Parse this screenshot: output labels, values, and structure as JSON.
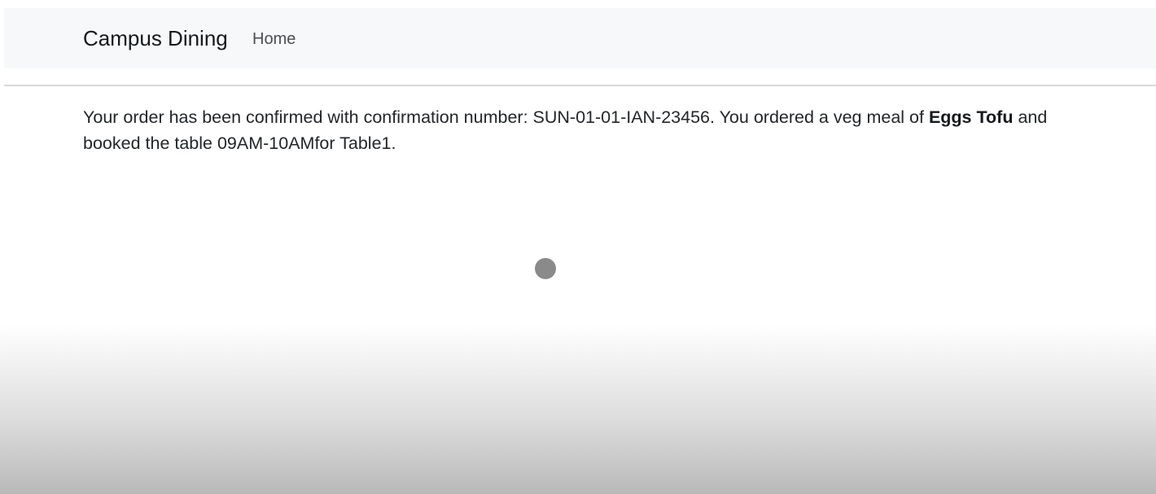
{
  "navbar": {
    "brand": "Campus Dining",
    "links": [
      {
        "label": "Home"
      }
    ]
  },
  "confirmation": {
    "text_before_meal": "Your order has been confirmed with confirmation number: SUN-01-01-IAN-23456. You ordered a veg meal of ",
    "meal": "Eggs Tofu",
    "text_after_meal": " and booked the table 09AM-10AMfor Table1."
  }
}
